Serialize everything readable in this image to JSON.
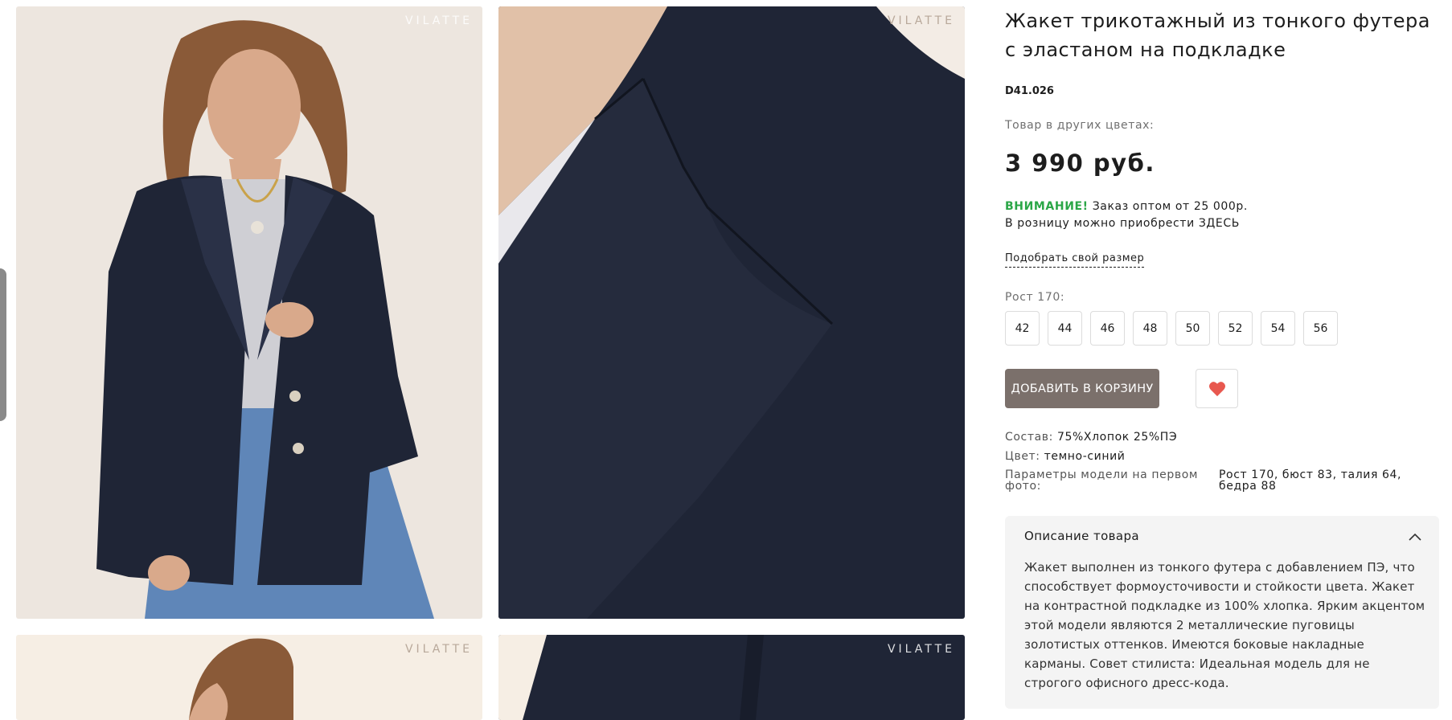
{
  "product": {
    "title": "Жакет трикотажный из тонкого футера с эластаном на подкладке",
    "sku": "D41.026",
    "other_colors_label": "Товар в других цветах:",
    "price": "3 990 руб.",
    "notice_warning": "ВНИМАНИЕ!",
    "notice_text": " Заказ оптом от 25 000р.",
    "notice_retail": "В розницу можно приобрести ЗДЕСЬ",
    "size_guide_link": "Подобрать свой размер",
    "height_label": "Рост 170:",
    "sizes": [
      "42",
      "44",
      "46",
      "48",
      "50",
      "52",
      "54",
      "56"
    ],
    "add_to_cart_label": "ДОБАВИТЬ В КОРЗИНУ",
    "composition_label": "Состав:",
    "composition_value": " 75%Хлопок 25%ПЭ",
    "color_label": "Цвет:",
    "color_value": " темно-синий",
    "model_params_label": "Параметры модели на первом фото:",
    "model_params_value": "Рост 170, бюст 83, талия 64, бедра 88",
    "description_title": "Описание товара",
    "description_text": "Жакет выполнен из тонкого футера с добавлением ПЭ, что способствует формоусточивости и стойкости цвета. Жакет на контрастной подкладке из 100% хлопка. Ярким акцентом этой модели являются 2 металлические пуговицы золотистых оттенков. Имеются боковые накладные карманы. Совет стилиста: Идеальная модель для не строгого офисного дресс-кода."
  },
  "gallery": {
    "watermark": "VILATTE"
  },
  "icons": {
    "favorite": "heart-icon",
    "collapse": "chevron-up-icon"
  },
  "colors": {
    "warning": "#2aa646",
    "button": "#7b706b",
    "heart": "#e8584f",
    "jacket": "#1f2536"
  }
}
